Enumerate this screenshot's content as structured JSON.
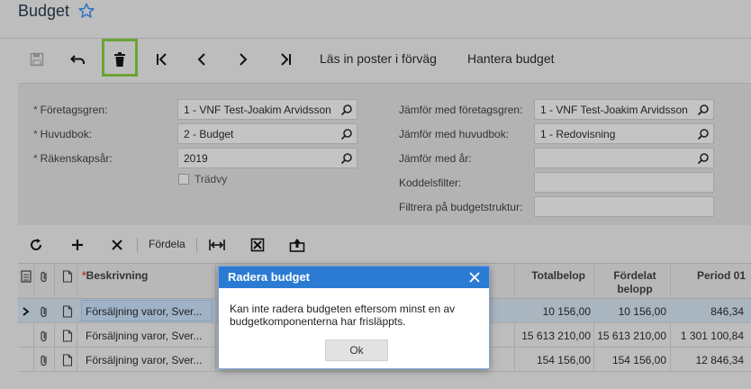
{
  "header": {
    "title": "Budget"
  },
  "toolbar": {
    "load_label": "Läs in poster i förväg",
    "manage_label": "Hantera budget"
  },
  "form": {
    "branch_label": "Företagsgren:",
    "branch_value": "1 - VNF Test-Joakim Arvidsson",
    "ledger_label": "Huvudbok:",
    "ledger_value": "2 - Budget",
    "year_label": "Räkenskapsår:",
    "year_value": "2019",
    "tree_label": "Trädvy",
    "cmp_branch_label": "Jämför med företagsgren:",
    "cmp_branch_value": "1 - VNF Test-Joakim Arvidsson",
    "cmp_ledger_label": "Jämför med huvudbok:",
    "cmp_ledger_value": "1 - Redovisning",
    "cmp_year_label": "Jämför med år:",
    "cmp_year_value": "",
    "code_filter_label": "Koddelsfilter:",
    "struct_filter_label": "Filtrera på budgetstruktur:",
    "required_mark": "*"
  },
  "grid_toolbar": {
    "distribute_label": "Fördela"
  },
  "grid": {
    "headers": {
      "description": "Beskrivning",
      "total": "Totalbelop",
      "distributed_1": "Fördelat",
      "distributed_2": "belopp",
      "period01": "Period 01"
    },
    "rows": [
      {
        "description": "Försäljning varor, Sver...",
        "total": "10 156,00",
        "distributed": "10 156,00",
        "period01": "846,34"
      },
      {
        "description": "Försäljning varor, Sver...",
        "total": "15 613 210,00",
        "distributed": "15 613 210,00",
        "period01": "1 301 100,84"
      },
      {
        "description": "Försäljning varor, Sver...",
        "total": "154 156,00",
        "distributed": "154 156,00",
        "period01": "12 846,34"
      }
    ]
  },
  "modal": {
    "title": "Radera budget",
    "message_1": "Kan inte radera budgeten eftersom minst en av",
    "message_2": "budgetkomponenterna har frisläppts.",
    "ok_label": "Ok"
  },
  "colors": {
    "modal_header": "#2b7bd3",
    "highlight_border": "#6aa434"
  }
}
